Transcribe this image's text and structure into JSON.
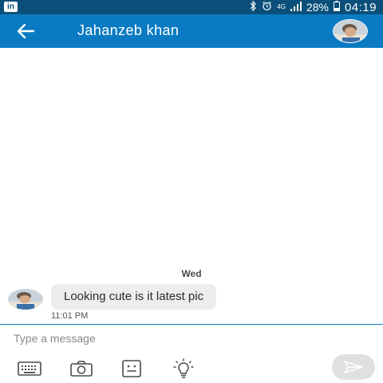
{
  "status_bar": {
    "app_logo": "in",
    "network": "4G",
    "battery": "28%",
    "time": "04:19"
  },
  "header": {
    "contact_name": "Jahanzeb khan"
  },
  "conversation": {
    "day_label": "Wed",
    "messages": [
      {
        "text": "Looking cute is it latest pic",
        "time": "11:01 PM"
      }
    ]
  },
  "composer": {
    "placeholder": "Type a message"
  },
  "icons": {
    "back": "arrow-left-icon",
    "keyboard": "keyboard-icon",
    "camera": "camera-icon",
    "sticker": "sticker-icon",
    "idea": "lightbulb-icon",
    "send": "send-icon"
  },
  "colors": {
    "status_bar": "#0a4f79",
    "app_bar": "#0a7bc2",
    "bubble": "#ecedee",
    "send_button": "#e0e0e0"
  }
}
